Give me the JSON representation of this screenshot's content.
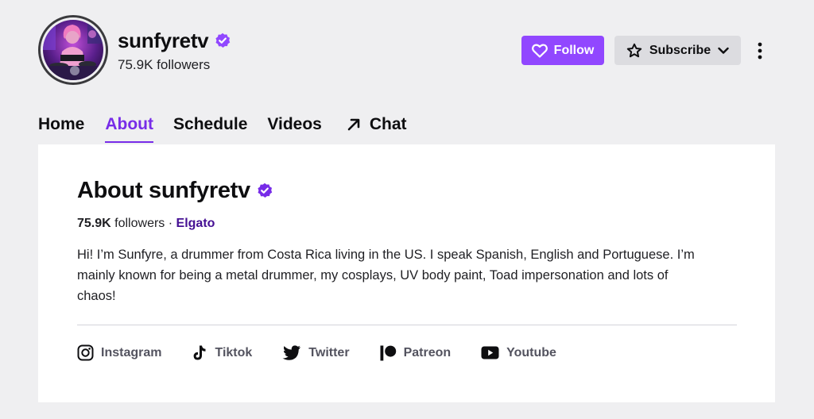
{
  "channel": {
    "name": "sunfyretv",
    "followers_text": "75.9K followers"
  },
  "actions": {
    "follow_label": "Follow",
    "subscribe_label": "Subscribe"
  },
  "tabs": [
    {
      "label": "Home"
    },
    {
      "label": "About",
      "active": true
    },
    {
      "label": "Schedule"
    },
    {
      "label": "Videos"
    },
    {
      "label": "Chat"
    }
  ],
  "about": {
    "title": "About sunfyretv",
    "followers_count": "75.9K",
    "followers_word": "followers",
    "separator": "·",
    "team": "Elgato",
    "bio": "Hi! I’m Sunfyre, a drummer from Costa Rica living in the US. I speak Spanish, English and Portuguese. I’m mainly known for being a metal drummer, my cosplays, UV body paint, Toad impersonation and lots of chaos!",
    "socials": [
      {
        "label": "Instagram",
        "icon": "instagram-icon"
      },
      {
        "label": "Tiktok",
        "icon": "tiktok-icon"
      },
      {
        "label": "Twitter",
        "icon": "twitter-icon"
      },
      {
        "label": "Patreon",
        "icon": "patreon-icon"
      },
      {
        "label": "Youtube",
        "icon": "youtube-icon"
      }
    ]
  },
  "colors": {
    "brand_purple": "#9147ff",
    "active_tab": "#772ce8",
    "team_link": "#451093",
    "background": "#efeff1"
  }
}
